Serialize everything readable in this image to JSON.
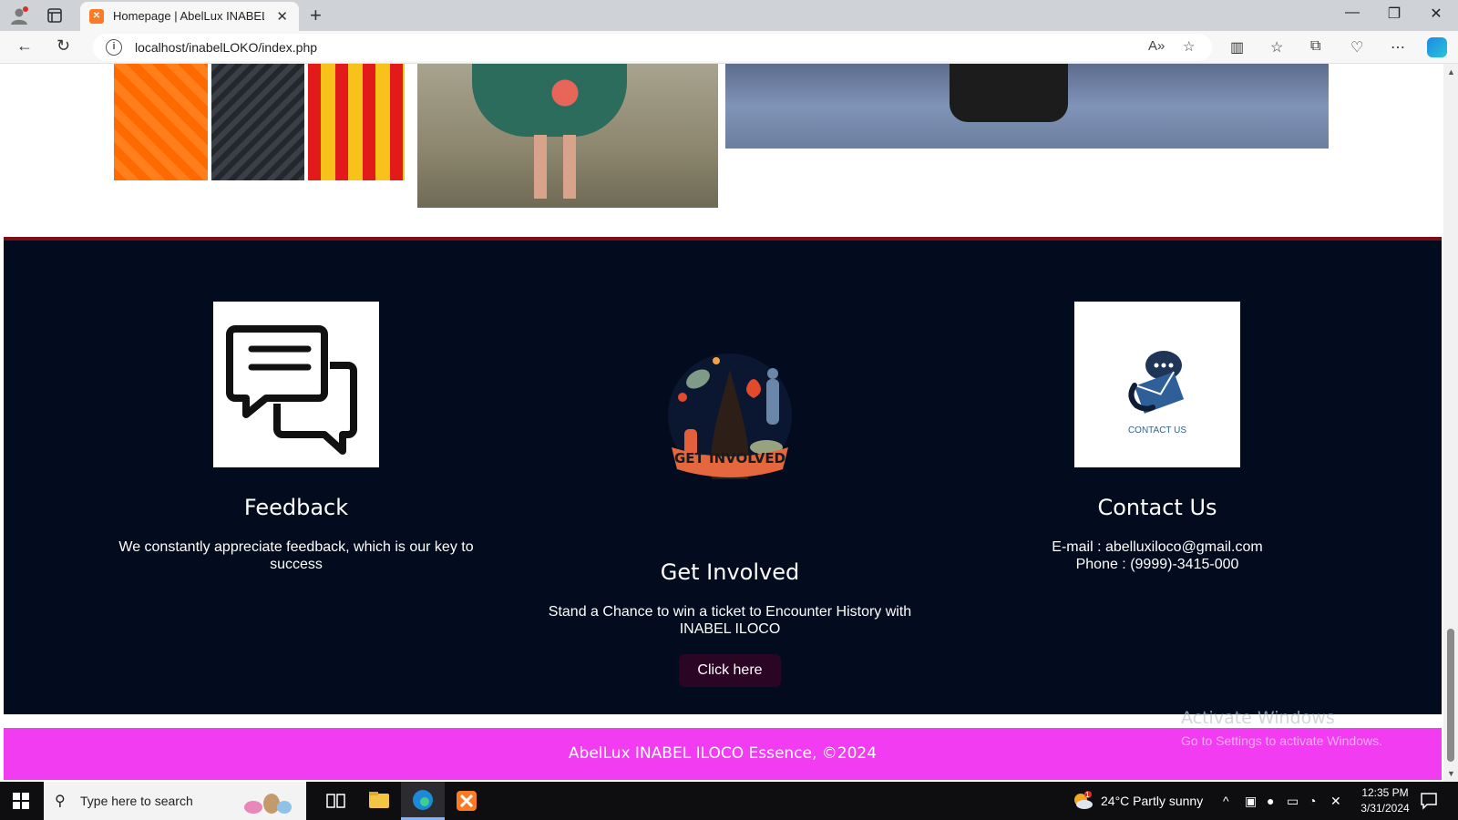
{
  "browser": {
    "tab_title": "Homepage | AbelLux INABEL ILOC",
    "tab_favicon": "XAMPP",
    "url": "localhost/inabelLOKO/index.php",
    "new_tab_label": "+",
    "colors": {
      "tabbar": "#cfd3d8",
      "toolbar": "#f7f7f7"
    }
  },
  "footer": {
    "feedback": {
      "icon": "chat-bubbles-icon",
      "title": "Feedback",
      "text": "We constantly appreciate feedback, which is our key to success"
    },
    "get_involved": {
      "logo_text": "GET INVOLVED",
      "title": "Get Involved",
      "text": "Stand a Chance to win a ticket to Encounter History with INABEL ILOCO",
      "button_label": "Click here"
    },
    "contact": {
      "icon": "contact-envelope-icon",
      "image_caption": "CONTACT US",
      "title": "Contact Us",
      "email": "E-mail : abelluxiloco@gmail.com",
      "phone": "Phone : (9999)-3415-000"
    },
    "copyright": "AbelLux INABEL ILOCO Essence, ©2024",
    "colors": {
      "background": "#020c1e",
      "border": "#7a0f18",
      "copyright_bar": "#f23cf2",
      "button": "#2b0524"
    }
  },
  "watermark": {
    "title": "Activate Windows",
    "subtitle": "Go to Settings to activate Windows."
  },
  "taskbar": {
    "search_placeholder": "Type here to search",
    "weather": "24°C  Partly sunny",
    "weather_badge": "1",
    "time": "12:35 PM",
    "date": "3/31/2024"
  }
}
